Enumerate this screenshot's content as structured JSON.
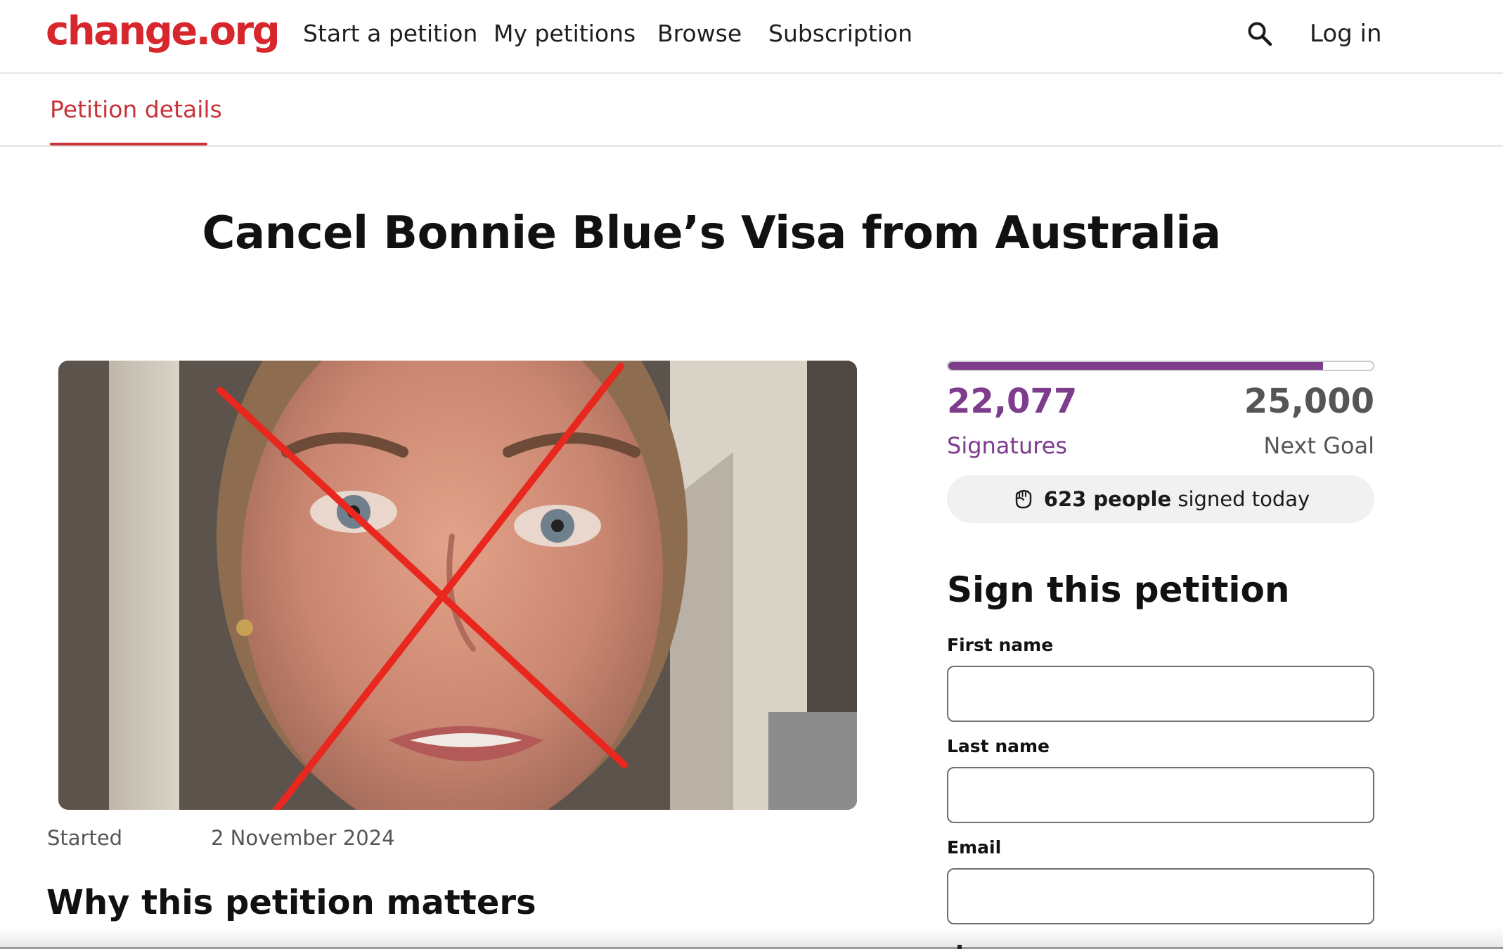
{
  "header": {
    "logo": "change.org",
    "nav": {
      "start_petition": "Start a petition",
      "my_petitions": "My petitions",
      "browse": "Browse",
      "subscription": "Subscription"
    },
    "login": "Log in",
    "icons": {
      "search": "search-icon"
    }
  },
  "tabs": {
    "active": "Petition details"
  },
  "petition": {
    "title": "Cancel Bonnie Blue’s Visa from Australia",
    "started_label": "Started",
    "started_date": "2 November 2024",
    "why_heading": "Why this petition matters"
  },
  "progress": {
    "signatures": "22,077",
    "signatures_label": "Signatures",
    "goal": "25,000",
    "goal_label": "Next Goal",
    "fraction": 0.883,
    "today_count": "623 people",
    "today_suffix": " signed today"
  },
  "sign_form": {
    "heading": "Sign this petition",
    "first_name_label": "First name",
    "last_name_label": "Last name",
    "email_label": "Email",
    "first_name_value": "",
    "last_name_value": "",
    "email_value": ""
  },
  "colors": {
    "brand": "#d7262c",
    "accent": "#7d3c8c",
    "tab_active": "#c8333a"
  }
}
